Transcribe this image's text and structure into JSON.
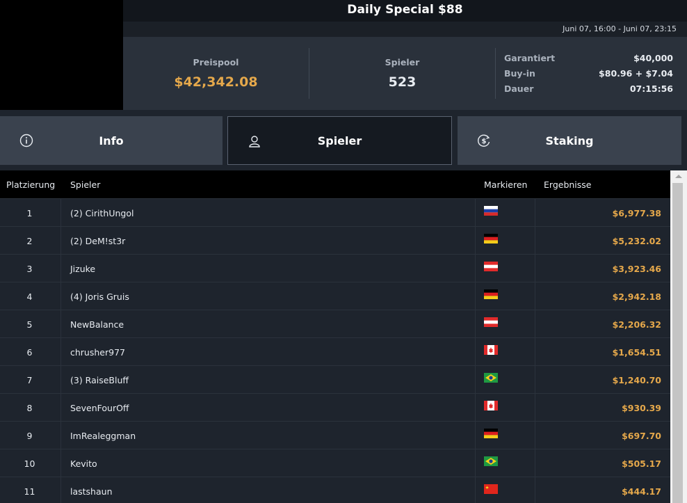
{
  "title": "Daily Special $88",
  "date_range": "Juni 07, 16:00 - Juni 07, 23:15",
  "stats": {
    "prizepool_label": "Preispool",
    "prizepool_value": "$42,342.08",
    "players_label": "Spieler",
    "players_value": "523",
    "details": [
      {
        "label": "Garantiert",
        "value": "$40,000"
      },
      {
        "label": "Buy-in",
        "value": "$80.96 + $7.04"
      },
      {
        "label": "Dauer",
        "value": "07:15:56"
      }
    ]
  },
  "tabs": [
    {
      "label": "Info",
      "icon": "info-icon"
    },
    {
      "label": "Spieler",
      "icon": "user-icon",
      "active": true
    },
    {
      "label": "Staking",
      "icon": "dollar-cycle-icon"
    }
  ],
  "table": {
    "headers": [
      "Platzierung",
      "Spieler",
      "Markieren",
      "Ergebnisse"
    ],
    "rows": [
      {
        "rank": "1",
        "player": "(2) CirithUngol",
        "flag": "russia",
        "result": "$6,977.38"
      },
      {
        "rank": "2",
        "player": "(2) DeM!st3r",
        "flag": "germany",
        "result": "$5,232.02"
      },
      {
        "rank": "3",
        "player": "Jizuke",
        "flag": "austria",
        "result": "$3,923.46"
      },
      {
        "rank": "4",
        "player": "(4) Joris Gruis",
        "flag": "germany",
        "result": "$2,942.18"
      },
      {
        "rank": "5",
        "player": "NewBalance",
        "flag": "austria",
        "result": "$2,206.32"
      },
      {
        "rank": "6",
        "player": "chrusher977",
        "flag": "canada",
        "result": "$1,654.51"
      },
      {
        "rank": "7",
        "player": "(3) RaiseBluff",
        "flag": "brazil",
        "result": "$1,240.70"
      },
      {
        "rank": "8",
        "player": "SevenFourOff",
        "flag": "canada",
        "result": "$930.39"
      },
      {
        "rank": "9",
        "player": "ImRealeggman",
        "flag": "germany",
        "result": "$697.70"
      },
      {
        "rank": "10",
        "player": "Kevito",
        "flag": "brazil",
        "result": "$505.17"
      },
      {
        "rank": "11",
        "player": "lastshaun",
        "flag": "china",
        "result": "$444.17"
      }
    ]
  },
  "colors": {
    "accent_gold": "#e5a84b",
    "background": "#1e242d"
  }
}
